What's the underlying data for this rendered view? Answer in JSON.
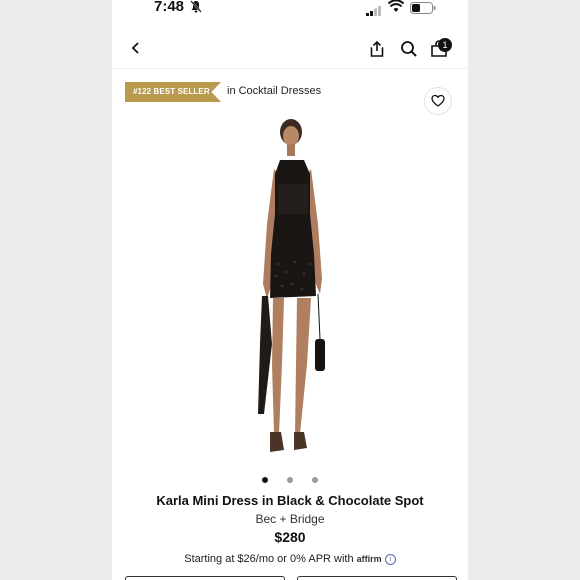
{
  "status_bar": {
    "time": "7:48"
  },
  "nav": {
    "cart_count": "1"
  },
  "product": {
    "rank_badge": "#122 BEST SELLER",
    "rank_category": "in Cocktail Dresses",
    "title": "Karla Mini Dress in Black & Chocolate Spot",
    "brand": "Bec + Bridge",
    "price": "$280",
    "image_dots": 3,
    "active_dot": 0
  },
  "financing": {
    "text": "Starting at $26/mo or 0% APR with",
    "provider": "affirm",
    "info_symbol": "i"
  },
  "colors": {
    "gold": "#b99a4f",
    "text": "#111111"
  }
}
